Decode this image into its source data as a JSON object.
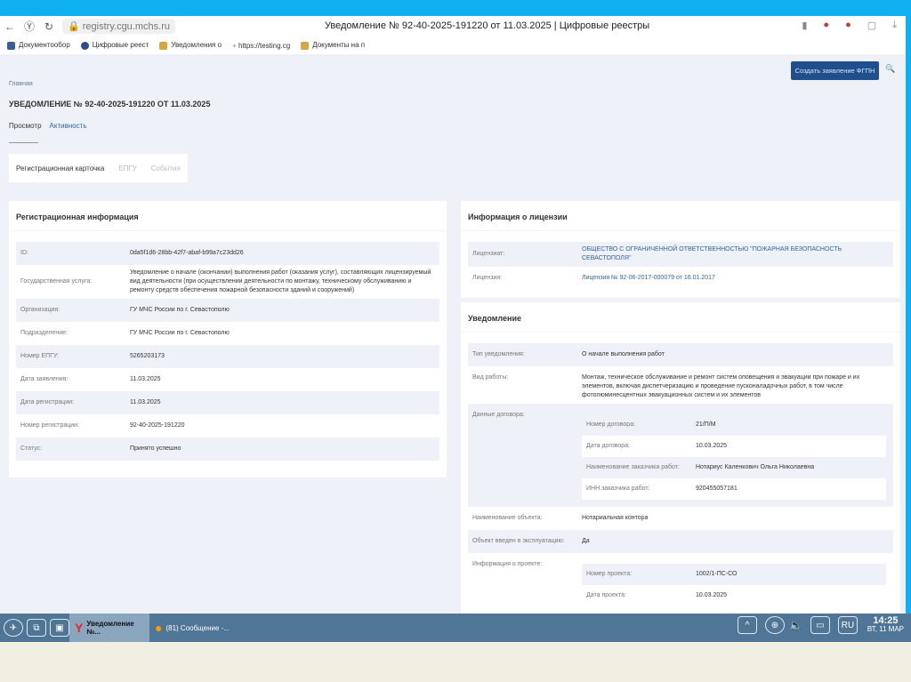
{
  "browser": {
    "url": "registry.cgu.mchs.ru",
    "title": "Уведомление № 92-40-2025-191220 от 11.03.2025 | Цифровые реестры",
    "bookmarks": [
      "Документообор",
      "Цифровые реест",
      "Уведомления о",
      "https://testing.cg",
      "Документы на п"
    ]
  },
  "page": {
    "breadcrumb": "Главная",
    "heading": "УВЕДОМЛЕНИЕ № 92-40-2025-191220 ОТ 11.03.2025",
    "create_button": "Создать заявление ФГПН",
    "subtabs": [
      "Просмотр",
      "Активность"
    ],
    "tabs": [
      "Регистрационная карточка",
      "ЕПГУ",
      "События"
    ]
  },
  "reg": {
    "title": "Регистрационная информация",
    "rows": [
      {
        "k": "ID:",
        "v": "0da5f1d6-28bb-42f7-abaf-b99a7c23dd26"
      },
      {
        "k": "Государственная услуга:",
        "v": "Уведомление о начале (окончании) выполнения работ (оказания услуг), составляющих лицензируемый вид деятельности (при осуществлении деятельности по монтажу, техническому обслуживанию и ремонту средств обеспечения пожарной безопасности зданий и сооружений)"
      },
      {
        "k": "Организация:",
        "v": "ГУ МЧС России по г. Севастополю"
      },
      {
        "k": "Подразделение:",
        "v": "ГУ МЧС России по г. Севастополю"
      },
      {
        "k": "Номер ЕПГУ:",
        "v": "5265203173"
      },
      {
        "k": "Дата заявления:",
        "v": "11.03.2025"
      },
      {
        "k": "Дата регистрации:",
        "v": "11.03.2025"
      },
      {
        "k": "Номер регистрации:",
        "v": "92-40-2025-191220"
      },
      {
        "k": "Статус:",
        "v": "Принято успешно"
      }
    ]
  },
  "license": {
    "title": "Информация о лицензии",
    "rows": [
      {
        "k": "Лицензиат:",
        "v": "ОБЩЕСТВО С ОГРАНИЧЕННОЙ ОТВЕТСТВЕННОСТЬЮ \"ПОЖАРНАЯ БЕЗОПАСНОСТЬ СЕВАСТОПОЛЯ\""
      },
      {
        "k": "Лицензия:",
        "v": "Лицензия № 92-06-2017-000079 от 16.01.2017"
      }
    ]
  },
  "notice": {
    "title": "Уведомление",
    "type_k": "Тип уведомления:",
    "type_v": "О начале выполнения работ",
    "work_k": "Вид работы:",
    "work_v": "Монтаж, техническое обслуживание и ремонт систем оповещения и эвакуации при пожаре и их элементов, включая диспетчеризацию и проведение пусконаладочных работ, в том числе фотолюминесцентных эвакуационных систем и их элементов",
    "contract_k": "Данные договора:",
    "contract": [
      {
        "k": "Номер договора:",
        "v": "21/П/М"
      },
      {
        "k": "Дата договора:",
        "v": "10.03.2025"
      },
      {
        "k": "Наименование заказчика работ:",
        "v": "Нотариус Каленкович Ольга Николаевна"
      },
      {
        "k": "ИНН заказчика работ:",
        "v": "920455057181"
      }
    ],
    "object_k": "Наименование объекта:",
    "object_v": "Нотариальная контора",
    "exploit_k": "Объект введен в эксплуатацию:",
    "exploit_v": "Да",
    "project_k": "Информация о проекте:",
    "project": [
      {
        "k": "Номер проекта:",
        "v": "1002/1-ПС-СО"
      },
      {
        "k": "Дата проекта:",
        "v": "10.03.2025"
      }
    ]
  },
  "taskbar": {
    "task1": "Уведомление №...",
    "task2": "(81) Сообщение -...",
    "lang": "RU",
    "time": "14:25",
    "date": "ВТ, 11 МАР"
  }
}
